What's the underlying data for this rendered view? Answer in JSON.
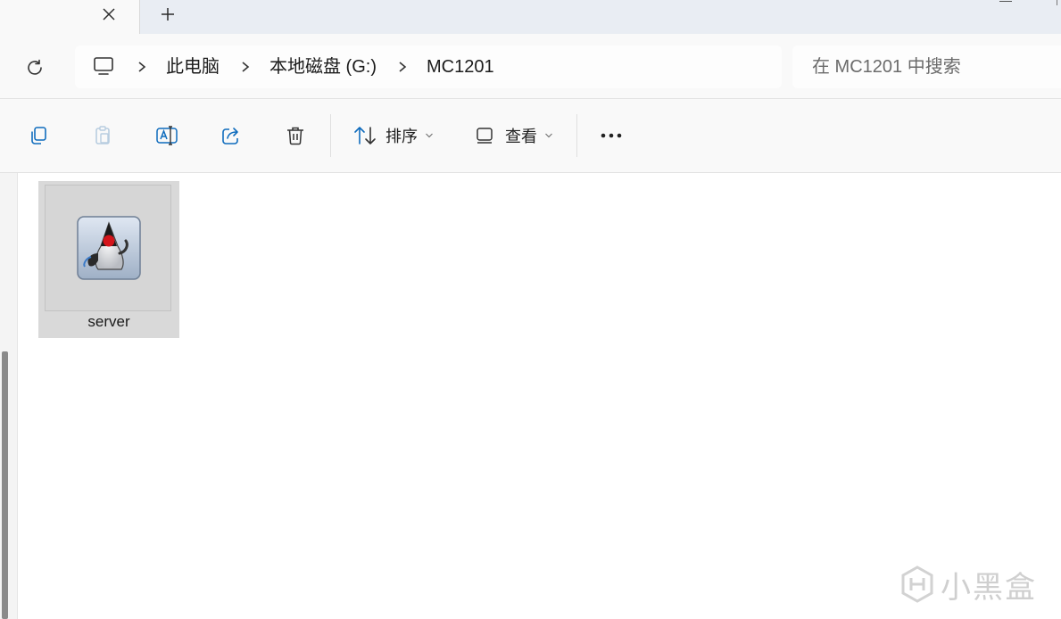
{
  "window": {
    "new_tab_glyph": "+",
    "close_tab_glyph": "✕"
  },
  "address": {
    "refresh_icon": "refresh-icon",
    "pc_icon": "computer-icon",
    "breadcrumb": [
      "此电脑",
      "本地磁盘 (G:)",
      "MC1201"
    ],
    "separator_glyph": "›",
    "search_placeholder": "在 MC1201 中搜索"
  },
  "toolbar": {
    "icons": [
      "copy-icon",
      "paste-icon",
      "rename-icon",
      "share-icon",
      "delete-icon"
    ],
    "sort_label": "排序",
    "view_label": "查看",
    "more_glyph": "•••",
    "accent": "#0f6cbd"
  },
  "files": [
    {
      "name": "server",
      "icon": "java-duke-icon",
      "selected": true
    }
  ],
  "watermark": {
    "text": "小黑盒"
  },
  "colors": {
    "tile_selected": "#d9d9d9",
    "chrome_bg": "#f9f9f9",
    "tab_strip": "#e9edf3"
  }
}
